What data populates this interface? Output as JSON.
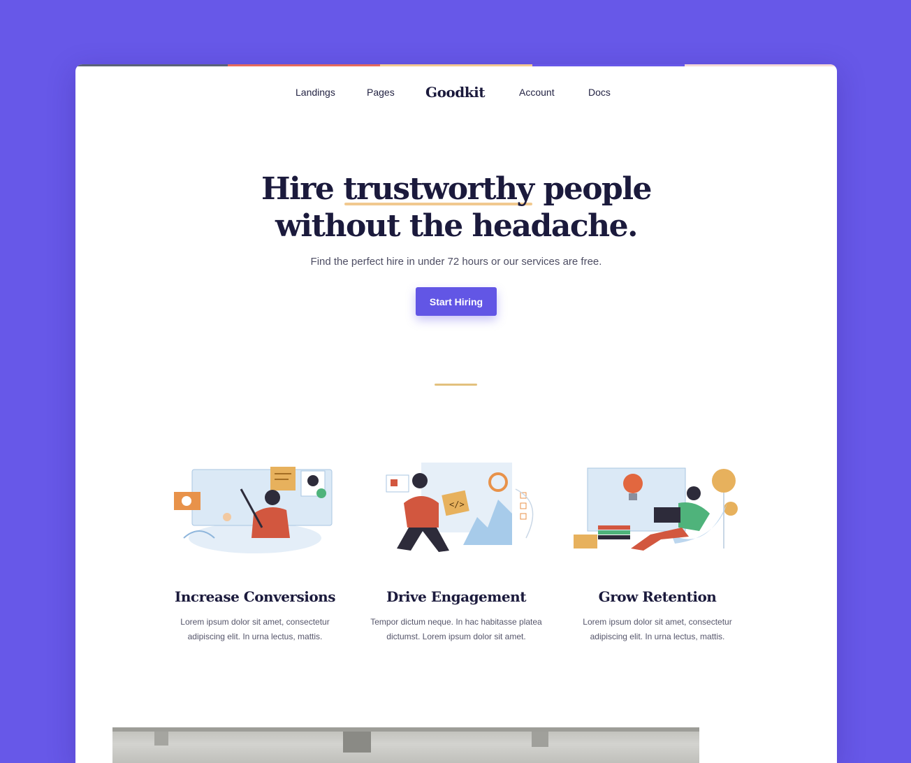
{
  "nav": {
    "items_left": [
      "Landings",
      "Pages"
    ],
    "logo": "Goodkit",
    "items_right": [
      "Account",
      "Docs"
    ]
  },
  "hero": {
    "title_line1_pre": "Hire ",
    "title_highlight": "trustworthy",
    "title_line1_post": " people",
    "title_line2": "without the headache.",
    "subtitle": "Find the perfect hire in under 72 hours or our services are free.",
    "cta_label": "Start Hiring"
  },
  "features": [
    {
      "title": "Increase Conversions",
      "text_line1": "Lorem ipsum dolor sit amet, consectetur",
      "text_line2": "adipiscing elit. In urna lectus, mattis.",
      "illustration": "designer-illustration"
    },
    {
      "title": "Drive Engagement",
      "text_line1": "Tempor dictum neque. In hac habitasse platea",
      "text_line2": "dictumst. Lorem ipsum dolor sit amet.",
      "illustration": "developer-illustration"
    },
    {
      "title": "Grow Retention",
      "text_line1": "Lorem ipsum dolor sit amet, consectetur",
      "text_line2": "adipiscing elit. In urna lectus, mattis.",
      "illustration": "relaxing-laptop-illustration"
    }
  ],
  "colors": {
    "background": "#6758e8",
    "accent": "#6256e5",
    "heading": "#1b1a3c",
    "highlight": "#f1c98f",
    "divider": "#e3c17e"
  }
}
